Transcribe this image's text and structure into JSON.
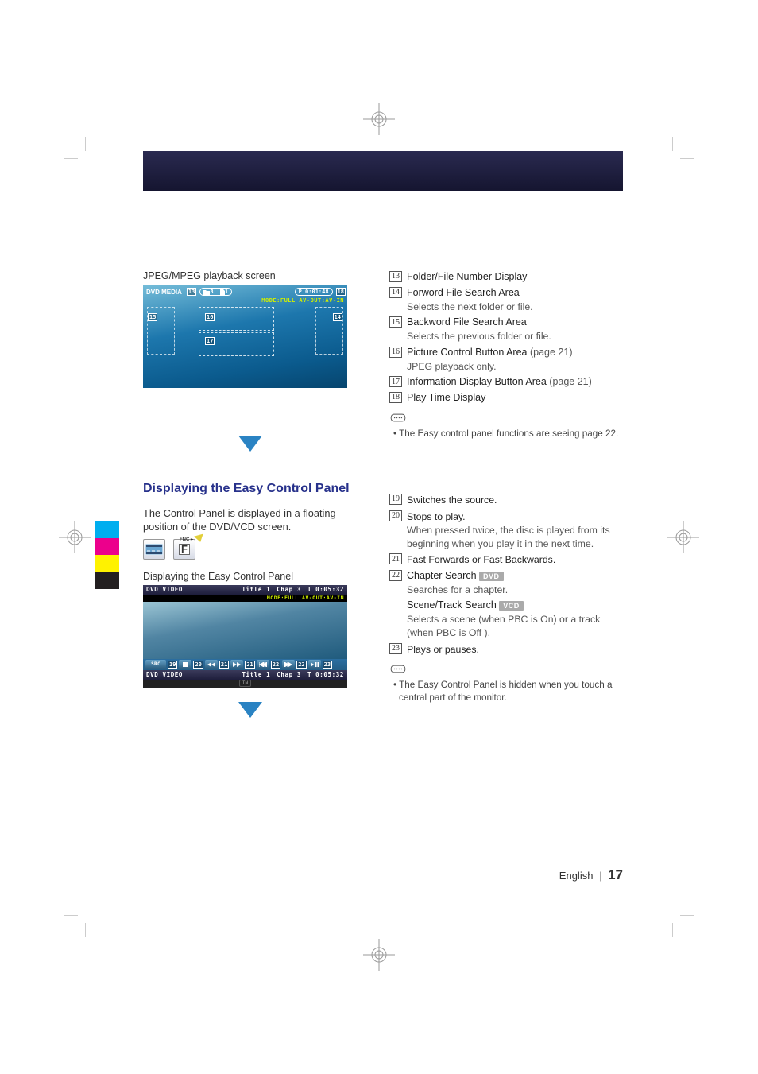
{
  "section_caption_1": "JPEG/MPEG playback screen",
  "screen1": {
    "source_label": "DVD MEDIA",
    "folder_num": "3",
    "file_num": "1",
    "play_time_label": "P   0:01:48",
    "mode_line": "MODE:FULL  AV-OUT:AV-IN"
  },
  "callouts_1": {
    "c13": "13",
    "c14": "14",
    "c15": "15",
    "c16": "16",
    "c17": "17",
    "c18": "18"
  },
  "list_1": [
    {
      "num": "13",
      "title": "Folder/File Number Display"
    },
    {
      "num": "14",
      "title": "Forword File Search Area",
      "desc": "Selects the next folder or file."
    },
    {
      "num": "15",
      "title": "Backword File Search Area",
      "desc": "Selects the previous folder or file."
    },
    {
      "num": "16",
      "title": "Picture Control Button Area",
      "page": "(page 21)",
      "desc": "JPEG playback only."
    },
    {
      "num": "17",
      "title": "Information Display Button Area",
      "page": "(page 21)"
    },
    {
      "num": "18",
      "title": "Play Time Display"
    }
  ],
  "tip_1": "The Easy control panel functions are seeing page 22.",
  "section_title_2": "Displaying the Easy Control Panel",
  "section_intro_2": "The Control Panel is displayed in a floating position of the DVD/VCD screen.",
  "button_labels": {
    "fnc": "F"
  },
  "screen2_caption": "Displaying the Easy Control Panel",
  "screen2": {
    "topbar_source": "DVD VIDEO",
    "topbar_title": "Title 1",
    "topbar_chap": "Chap 3",
    "topbar_time": "T 0:05:32",
    "subbar": "MODE:FULL  AV-OUT:AV-IN",
    "ctrl_src": "SRC",
    "botbar_title": "Title 1",
    "botbar_chap": "Chap 3",
    "botbar_time": "T 0:05:32",
    "in_label": "IN"
  },
  "callouts_2": {
    "c19": "19",
    "c20": "20",
    "c21a": "21",
    "c21b": "21",
    "c22a": "22",
    "c22b": "22",
    "c23": "23"
  },
  "list_2": [
    {
      "num": "19",
      "desc": "Switches the source."
    },
    {
      "num": "20",
      "desc": "Stops to play.",
      "desc2": "When pressed twice, the disc is played from its beginning when you play it in the next time."
    },
    {
      "num": "21",
      "desc": "Fast Forwards or Fast Backwards."
    },
    {
      "num": "22",
      "sub": [
        {
          "title": "Chapter Search",
          "badge": "DVD",
          "desc": "Searches for a chapter."
        },
        {
          "title": "Scene/Track Search",
          "badge": "VCD",
          "desc": "Selects a scene (when PBC is On) or a track (when PBC is Off )."
        }
      ]
    },
    {
      "num": "23",
      "desc": "Plays or pauses."
    }
  ],
  "tip_2": "The Easy Control Panel is hidden when you touch a central part of the monitor.",
  "footer": {
    "lang": "English",
    "page": "17"
  }
}
